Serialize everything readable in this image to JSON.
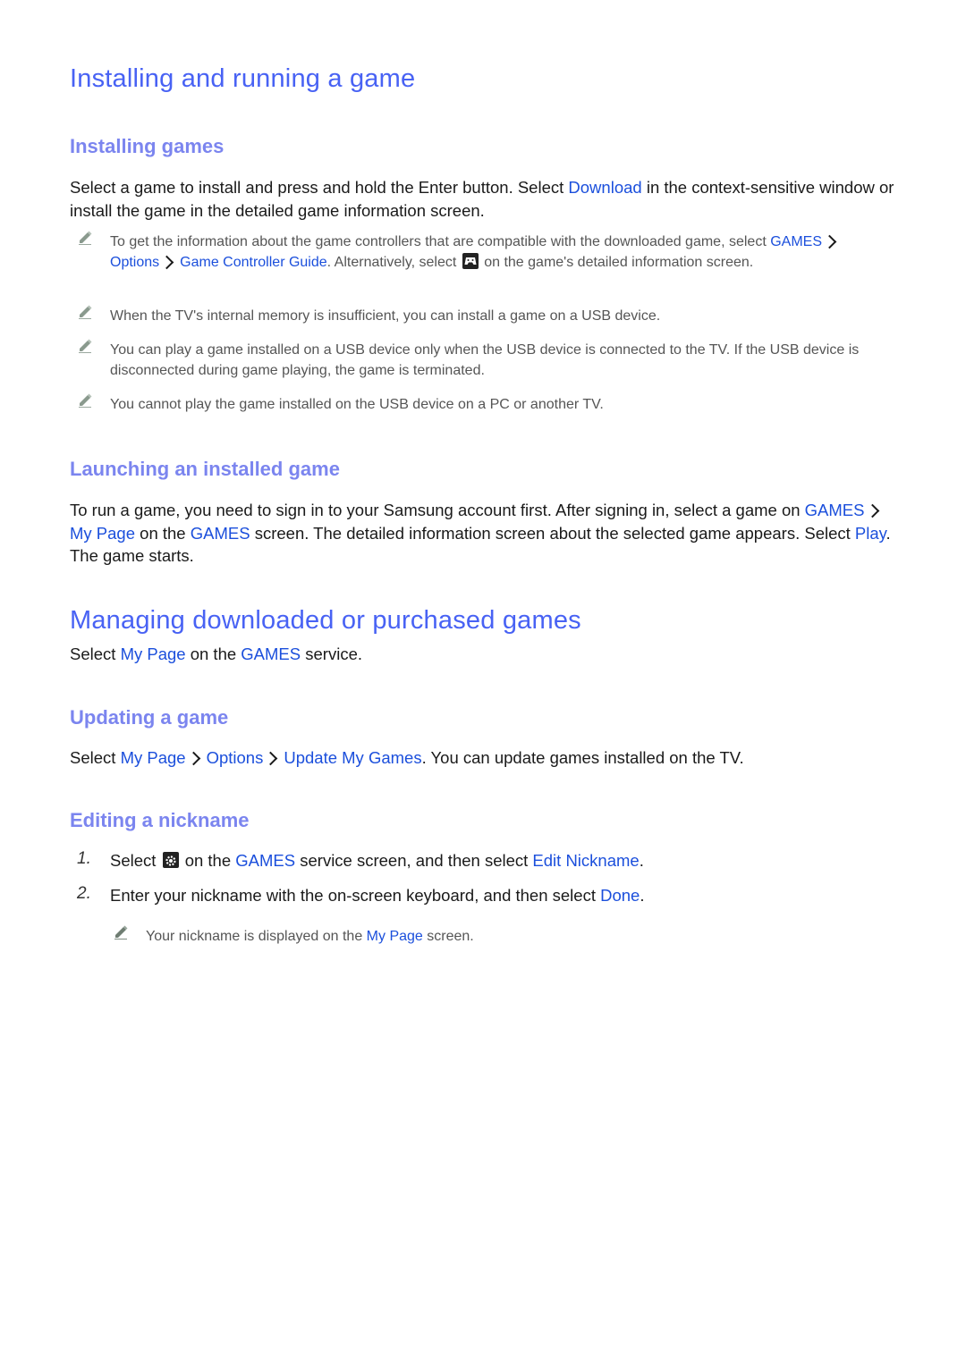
{
  "section1": {
    "title": "Installing and running a game",
    "installing": {
      "heading": "Installing games",
      "para": {
        "t1": "Select a game to install and press and hold the Enter button. Select ",
        "l1": "Download",
        "t2": " in the context-sensitive window or install the game in the detailed game information screen."
      },
      "notes": [
        {
          "t1": "To get the information about the game controllers that are compatible with the downloaded game, select ",
          "l1": "GAMES",
          "l2": "Options",
          "l3": "Game Controller Guide",
          "t2": ". Alternatively, select ",
          "icon": "gamepad-icon",
          "t3": " on the game's detailed information screen."
        },
        {
          "text": "When the TV's internal memory is insufficient, you can install a game on a USB device."
        },
        {
          "text": "You can play a game installed on a USB device only when the USB device is connected to the TV. If the USB device is disconnected during game playing, the game is terminated."
        },
        {
          "text": "You cannot play the game installed on the USB device on a PC or another TV."
        }
      ]
    },
    "launching": {
      "heading": "Launching an installed game",
      "t1": "To run a game, you need to sign in to your Samsung account first. After signing in, select a game on ",
      "l1": "GAMES",
      "l2": "My Page",
      "t2": " on the ",
      "l3": "GAMES",
      "t3": " screen. The detailed information screen about the selected game appears. Select ",
      "l4": "Play",
      "t4": ". The game starts."
    }
  },
  "section2": {
    "title": "Managing downloaded or purchased games",
    "intro": {
      "t1": "Select ",
      "l1": "My Page",
      "t2": " on the ",
      "l2": "GAMES",
      "t3": " service."
    },
    "updating": {
      "heading": "Updating a game",
      "t1": "Select ",
      "l1": "My Page",
      "l2": "Options",
      "l3": "Update My Games",
      "t2": ". You can update games installed on the TV."
    },
    "nickname": {
      "heading": "Editing a nickname",
      "steps": [
        {
          "num": "1.",
          "t1": "Select ",
          "icon": "settings-icon",
          "t2": " on the ",
          "l1": "GAMES",
          "t3": " service screen, and then select ",
          "l2": "Edit Nickname",
          "t4": "."
        },
        {
          "num": "2.",
          "t1": "Enter your nickname with the on-screen keyboard, and then select ",
          "l1": "Done",
          "t2": "."
        }
      ],
      "note": {
        "t1": "Your nickname is displayed on the ",
        "l1": "My Page",
        "t2": " screen."
      }
    }
  }
}
